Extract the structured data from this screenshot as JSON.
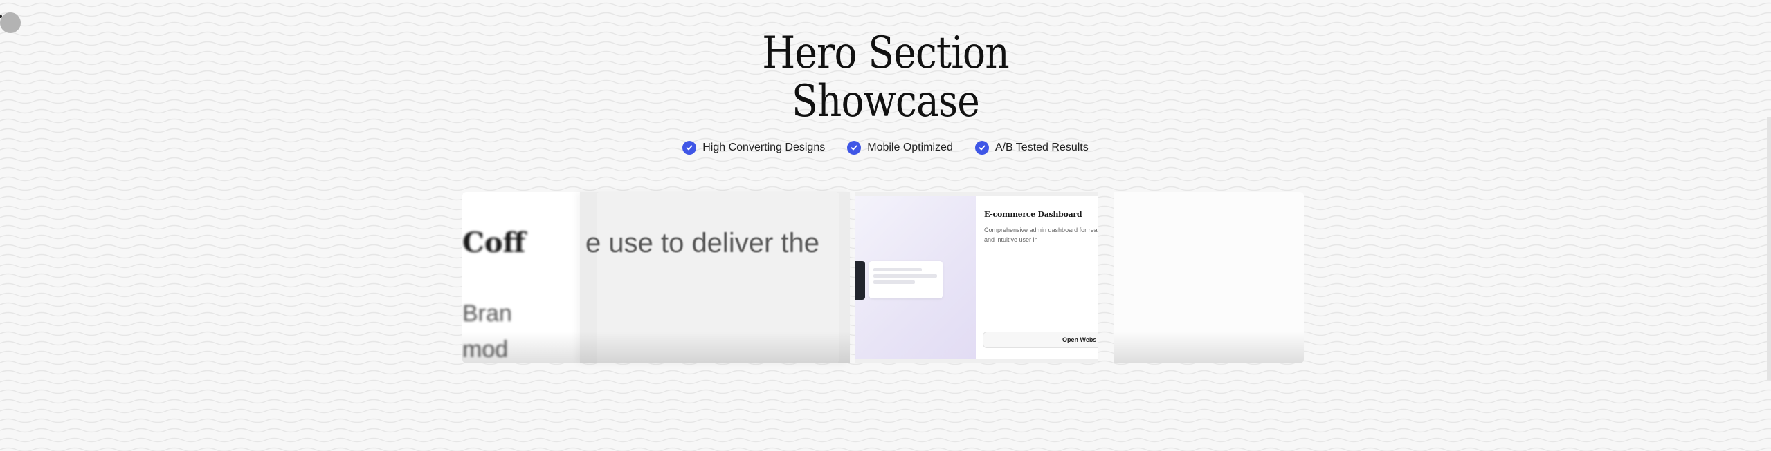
{
  "page": {
    "title_line1": "Hero Section",
    "title_line2": "Showcase"
  },
  "features": [
    {
      "label": "High Converting Designs",
      "icon": "check-circle-icon"
    },
    {
      "label": "Mobile Optimized",
      "icon": "check-circle-icon"
    },
    {
      "label": "A/B Tested Results",
      "icon": "check-circle-icon"
    }
  ],
  "cards": {
    "coffee": {
      "title_fragment": "Coff",
      "body_line1": "Bran",
      "body_line2": "mod"
    },
    "zoom": {
      "text_fragment": "e use to deliver the"
    },
    "ecommerce": {
      "title": "E-commerce Dashboard",
      "description": "Comprehensive admin dashboard for real-time analytics and intuitive user in",
      "button_label": "Open Webs"
    }
  },
  "colors": {
    "accent": "#3f56e6",
    "background": "#f6f6f6"
  }
}
